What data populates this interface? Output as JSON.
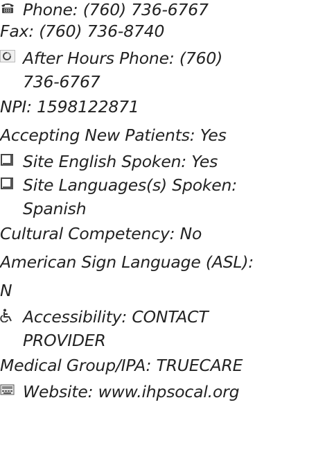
{
  "icons": {
    "phone": "telephone-icon",
    "after_hours": "circle-icon",
    "english": "checkbox-icon",
    "languages": "checkbox-icon",
    "accessibility": "wheelchair-icon",
    "website": "keyboard-icon"
  },
  "provider": {
    "phone": "Phone: (760) 736-6767",
    "fax": "Fax: (760) 736-8740",
    "after_hours_1": "After Hours Phone: (760)",
    "after_hours_2": "736-6767",
    "npi": "NPI: 1598122871",
    "accepting": "Accepting New Patients: Yes",
    "english": "Site English Spoken: Yes",
    "languages_1": "Site Languages(s) Spoken:",
    "languages_2": "Spanish",
    "cultural": "Cultural Competency: No",
    "asl_1": "American Sign Language (ASL):",
    "asl_2": "N",
    "accessibility_1": "Accessibility: CONTACT",
    "accessibility_2": "PROVIDER",
    "medical_group": "Medical Group/IPA: TRUECARE",
    "website": "Website: www.ihpsocal.org"
  }
}
